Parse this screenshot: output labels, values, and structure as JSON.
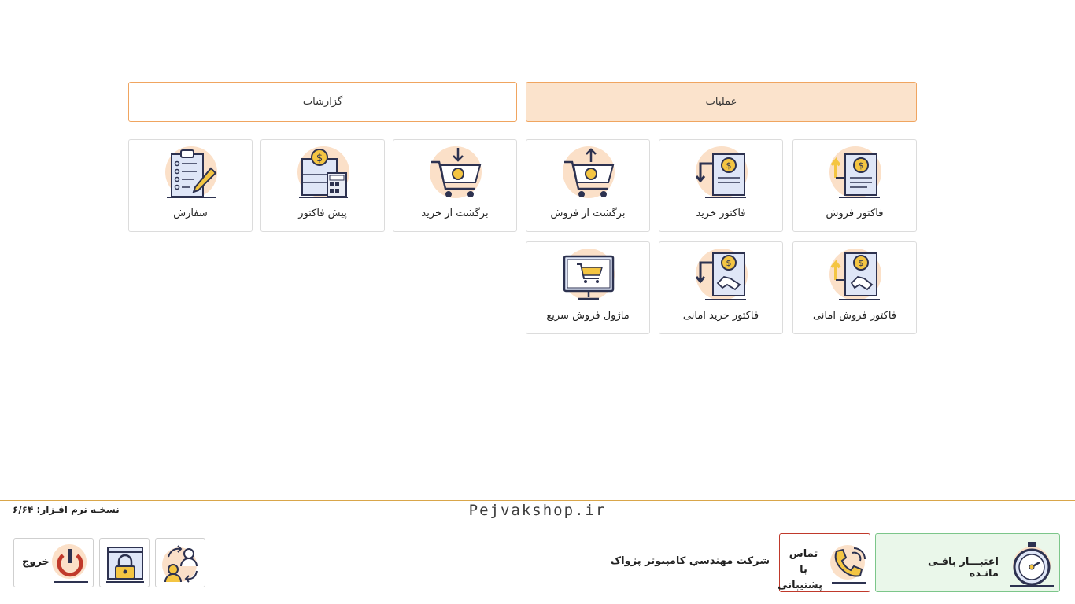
{
  "tabs": [
    {
      "label": "عملیات",
      "active": true
    },
    {
      "label": "گزارشات",
      "active": false
    }
  ],
  "tiles": {
    "sales_invoice": {
      "label": "فاکتور فروش",
      "icon": "sales-invoice-icon"
    },
    "purchase_invoice": {
      "label": "فاکتور خرید",
      "icon": "purchase-invoice-icon"
    },
    "sales_return": {
      "label": "برگشت از فروش",
      "icon": "cart-return-up-icon"
    },
    "purchase_return": {
      "label": "برگشت از خرید",
      "icon": "cart-return-down-icon"
    },
    "proforma": {
      "label": "پیش فاکتور",
      "icon": "proforma-calculator-icon"
    },
    "order": {
      "label": "سفارش",
      "icon": "clipboard-order-icon"
    },
    "consignment_sales": {
      "label": "فاکتور فروش امانی",
      "icon": "consignment-sales-icon"
    },
    "consignment_purchase": {
      "label": "فاکتور خرید امانی",
      "icon": "consignment-purchase-icon"
    },
    "quick_sale": {
      "label": "ماژول فروش سریع",
      "icon": "monitor-cart-icon"
    }
  },
  "footer": {
    "brand": "Pejvakshop.ir",
    "version": "نسخـه نرم افـزار: ۶/۶۴"
  },
  "bottom": {
    "exit_label": "خروج",
    "company": "شرکت مهندسي کامپيوتر پژواک",
    "support_line1": "تماس با",
    "support_line2": "پشتیبانی",
    "credit_label": "اعتبـــار باقـی مانـده"
  },
  "colors": {
    "accent_orange": "#f0a560",
    "tab_active_bg": "#fbe3cc",
    "icon_circle": "#fbe0c8",
    "icon_stroke": "#2d3250",
    "icon_yellow": "#f4c542",
    "credit_bg": "#eaf7ea",
    "support_border": "#c0392b"
  }
}
